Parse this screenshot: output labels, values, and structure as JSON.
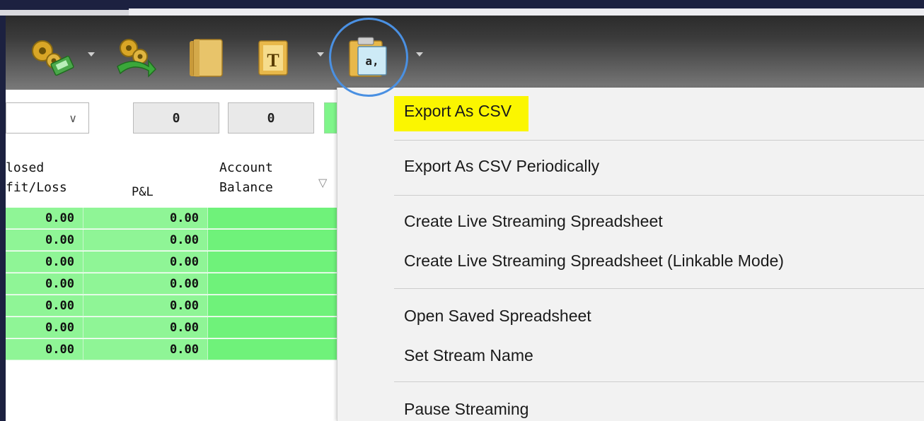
{
  "toolbar": {
    "buttons": [
      {
        "name": "gears-money-icon"
      },
      {
        "name": "gears-refresh-icon"
      },
      {
        "name": "folder-icon"
      },
      {
        "name": "text-template-icon",
        "glyph": "T"
      },
      {
        "name": "clipboard-csv-icon",
        "glyph": "a,"
      }
    ]
  },
  "filters": {
    "combo_value": "",
    "box1": "0",
    "box2": "0"
  },
  "grid": {
    "headers": {
      "closed_line1": "losed",
      "closed_line2": "fit/Loss",
      "pnl": "P&L",
      "balance_line1": "Account",
      "balance_line2": "Balance"
    },
    "rows": [
      {
        "closed": "0.00",
        "pnl": "0.00"
      },
      {
        "closed": "0.00",
        "pnl": "0.00"
      },
      {
        "closed": "0.00",
        "pnl": "0.00"
      },
      {
        "closed": "0.00",
        "pnl": "0.00"
      },
      {
        "closed": "0.00",
        "pnl": "0.00"
      },
      {
        "closed": "0.00",
        "pnl": "0.00"
      },
      {
        "closed": "0.00",
        "pnl": "0.00"
      }
    ]
  },
  "menu": {
    "export_csv": "Export As CSV",
    "export_csv_periodically": "Export As CSV Periodically",
    "create_live": "Create Live Streaming Spreadsheet",
    "create_live_linkable": "Create Live Streaming Spreadsheet (Linkable Mode)",
    "open_saved": "Open Saved Spreadsheet",
    "set_stream_name": "Set Stream Name",
    "pause_streaming": "Pause Streaming"
  },
  "colors": {
    "highlight": "#fbf600",
    "row_green": "#8ff596",
    "annotation_circle": "#4a90e2"
  }
}
